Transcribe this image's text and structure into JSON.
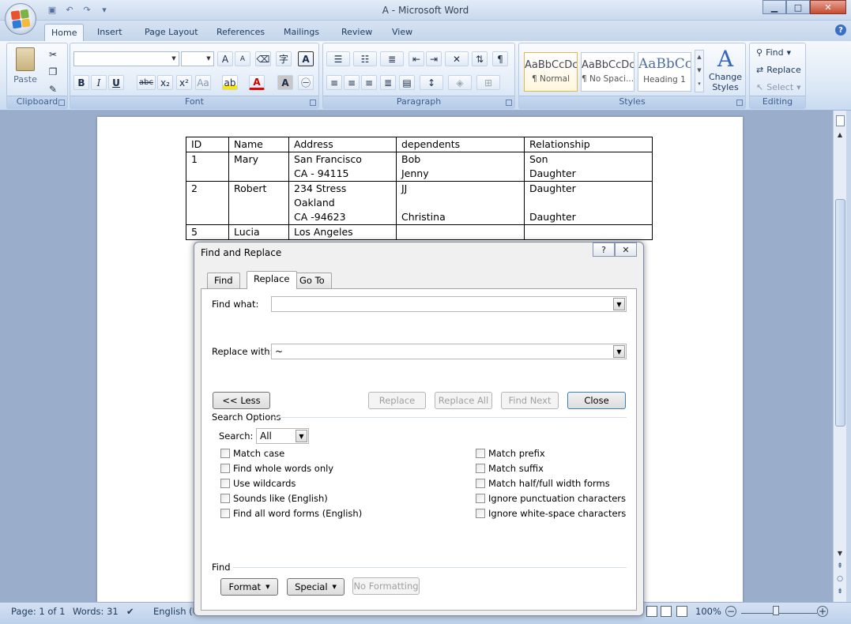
{
  "window": {
    "title": "A - Microsoft Word",
    "minimize": "▁",
    "maximize": "□",
    "close": "✕"
  },
  "ribbon_tabs": [
    "Home",
    "Insert",
    "Page Layout",
    "References",
    "Mailings",
    "Review",
    "View"
  ],
  "ribbon": {
    "clipboard": {
      "label": "Clipboard",
      "paste": "Paste"
    },
    "font": {
      "label": "Font",
      "bold": "B",
      "italic": "I",
      "underline": "U",
      "strike": "abc",
      "subscript": "x₂",
      "superscript": "x²",
      "case": "Aa",
      "grow": "A",
      "shrink": "A",
      "clear": "A"
    },
    "paragraph": {
      "label": "Paragraph",
      "pilcrow": "¶"
    },
    "styles": {
      "label": "Styles",
      "items": [
        {
          "sample": "AaBbCcDc",
          "name": "¶ Normal"
        },
        {
          "sample": "AaBbCcDc",
          "name": "¶ No Spaci..."
        },
        {
          "sample": "AaBbCc",
          "name": "Heading 1"
        }
      ],
      "change_styles_line1": "Change",
      "change_styles_line2": "Styles"
    },
    "editing": {
      "label": "Editing",
      "find": "Find",
      "replace": "Replace",
      "select": "Select"
    }
  },
  "document_table": {
    "headers": [
      "ID",
      "Name",
      "Address",
      "dependents",
      "Relationship"
    ],
    "rows": [
      {
        "id": "1",
        "name": "Mary",
        "address": [
          "San Francisco",
          "CA - 94115"
        ],
        "dependents": [
          "Bob",
          "Jenny"
        ],
        "relationship": [
          "Son",
          "Daughter"
        ]
      },
      {
        "id": "2",
        "name": "Robert",
        "address": [
          "234 Stress",
          "Oakland",
          "CA -94623"
        ],
        "dependents": [
          "JJ",
          "",
          "Christina"
        ],
        "relationship": [
          "Daughter",
          "",
          "Daughter"
        ]
      },
      {
        "id": "5",
        "name": "Lucia",
        "address": [
          "Los Angeles"
        ],
        "dependents": [
          ""
        ],
        "relationship": [
          ""
        ]
      }
    ]
  },
  "dialog": {
    "title": "Find and Replace",
    "help": "?",
    "close": "✕",
    "tabs": [
      "Find",
      "Replace",
      "Go To"
    ],
    "find_what_label": "Find what:",
    "find_what_value": "",
    "replace_with_label": "Replace with:",
    "replace_with_value": "~",
    "less_button": "<< Less",
    "replace_button": "Replace",
    "replace_all_button": "Replace All",
    "find_next_button": "Find Next",
    "close_button": "Close",
    "search_options_label": "Search Options",
    "search_label": "Search:",
    "search_value": "All",
    "options_left": [
      "Match case",
      "Find whole words only",
      "Use wildcards",
      "Sounds like (English)",
      "Find all word forms (English)"
    ],
    "options_right": [
      "Match prefix",
      "Match suffix",
      "Match half/full width forms",
      "Ignore punctuation characters",
      "Ignore white-space characters"
    ],
    "find_section_label": "Find",
    "format_button": "Format",
    "special_button": "Special",
    "no_formatting_button": "No Formatting"
  },
  "status": {
    "page": "Page: 1 of 1",
    "words": "Words: 31",
    "language": "English (U",
    "zoom": "100%"
  }
}
